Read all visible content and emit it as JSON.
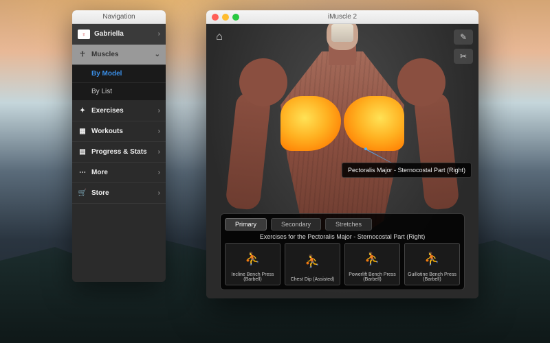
{
  "nav": {
    "window_title": "Navigation",
    "profile_name": "Gabriella",
    "muscles_label": "Muscles",
    "muscles_expanded": true,
    "muscles_sub": [
      {
        "label": "By Model",
        "active": true
      },
      {
        "label": "By List",
        "active": false
      }
    ],
    "items": [
      {
        "icon": "✦",
        "label": "Exercises"
      },
      {
        "icon": "▦",
        "label": "Workouts"
      },
      {
        "icon": "▤",
        "label": "Progress & Stats"
      },
      {
        "icon": "⋯",
        "label": "More"
      },
      {
        "icon": "🛒",
        "label": "Store"
      }
    ]
  },
  "main": {
    "window_title": "iMuscle 2",
    "selected_muscle": "Pectoralis Major - Sternocostal Part (Right)",
    "tabs": [
      {
        "label": "Primary",
        "active": true
      },
      {
        "label": "Secondary",
        "active": false
      },
      {
        "label": "Stretches",
        "active": false
      }
    ],
    "exercises_header": "Exercises for the Pectoralis Major - Sternocostal Part (Right)",
    "exercises": [
      {
        "label": "Incline Bench Press (Barbell)"
      },
      {
        "label": "Chest Dip (Assisted)"
      },
      {
        "label": "Powerlift Bench Press (Barbell)"
      },
      {
        "label": "Guillotine Bench Press (Barbell)"
      }
    ],
    "tools": [
      {
        "name": "scalpel-add-icon",
        "glyph": "✎"
      },
      {
        "name": "scalpel-icon",
        "glyph": "✂"
      }
    ]
  }
}
